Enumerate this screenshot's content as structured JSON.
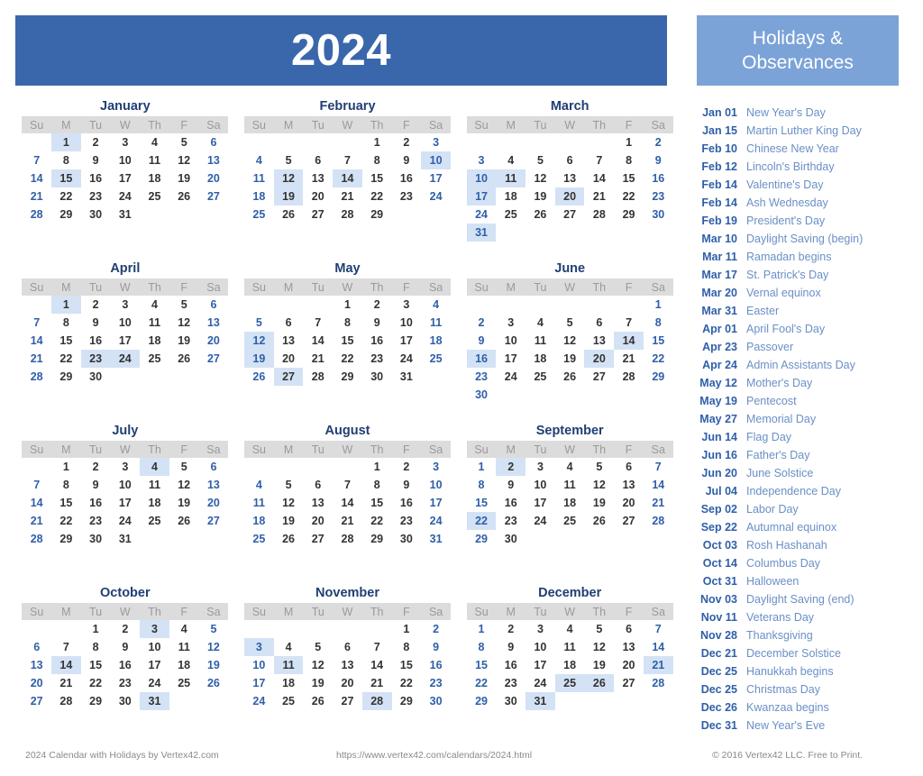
{
  "header": {
    "year": "2024",
    "holidays_title_line1": "Holidays &",
    "holidays_title_line2": "Observances"
  },
  "weekdays": [
    "Su",
    "M",
    "Tu",
    "W",
    "Th",
    "F",
    "Sa"
  ],
  "colors": {
    "banner_blue": "#3a67ab",
    "holidays_banner_blue": "#7ba3d8",
    "weekday_header_gray": "#dcdcdc",
    "weekend_blue": "#2f5fa8",
    "weekday_text": "#333333",
    "highlight_blue": "#d4e2f5",
    "month_title_blue": "#1f3f73",
    "holiday_name_blue": "#6a8fc7",
    "footer_gray": "#8a8a8a"
  },
  "months": [
    {
      "name": "January",
      "first_weekday": 1,
      "days": 31,
      "highlights": [
        1,
        15
      ]
    },
    {
      "name": "February",
      "first_weekday": 4,
      "days": 29,
      "highlights": [
        10,
        12,
        14,
        19
      ]
    },
    {
      "name": "March",
      "first_weekday": 5,
      "days": 31,
      "highlights": [
        10,
        11,
        17,
        20,
        31
      ]
    },
    {
      "name": "April",
      "first_weekday": 1,
      "days": 30,
      "highlights": [
        1,
        23,
        24
      ]
    },
    {
      "name": "May",
      "first_weekday": 3,
      "days": 31,
      "highlights": [
        12,
        19,
        27
      ]
    },
    {
      "name": "June",
      "first_weekday": 6,
      "days": 30,
      "highlights": [
        14,
        16,
        20
      ]
    },
    {
      "name": "July",
      "first_weekday": 1,
      "days": 31,
      "highlights": [
        4
      ]
    },
    {
      "name": "August",
      "first_weekday": 4,
      "days": 31,
      "highlights": []
    },
    {
      "name": "September",
      "first_weekday": 0,
      "days": 30,
      "highlights": [
        2,
        22
      ]
    },
    {
      "name": "October",
      "first_weekday": 2,
      "days": 31,
      "highlights": [
        3,
        14,
        31
      ]
    },
    {
      "name": "November",
      "first_weekday": 5,
      "days": 30,
      "highlights": [
        3,
        11,
        28
      ]
    },
    {
      "name": "December",
      "first_weekday": 0,
      "days": 31,
      "highlights": [
        21,
        25,
        26,
        31
      ]
    }
  ],
  "holidays": [
    {
      "date": "Jan 01",
      "name": "New Year's Day"
    },
    {
      "date": "Jan 15",
      "name": "Martin Luther King Day"
    },
    {
      "date": "Feb 10",
      "name": "Chinese New Year"
    },
    {
      "date": "Feb 12",
      "name": "Lincoln's Birthday"
    },
    {
      "date": "Feb 14",
      "name": "Valentine's Day"
    },
    {
      "date": "Feb 14",
      "name": "Ash Wednesday"
    },
    {
      "date": "Feb 19",
      "name": "President's Day"
    },
    {
      "date": "Mar 10",
      "name": "Daylight Saving (begin)"
    },
    {
      "date": "Mar 11",
      "name": "Ramadan begins"
    },
    {
      "date": "Mar 17",
      "name": "St. Patrick's Day"
    },
    {
      "date": "Mar 20",
      "name": "Vernal equinox"
    },
    {
      "date": "Mar 31",
      "name": "Easter"
    },
    {
      "date": "Apr 01",
      "name": "April Fool's Day"
    },
    {
      "date": "Apr 23",
      "name": "Passover"
    },
    {
      "date": "Apr 24",
      "name": "Admin Assistants Day"
    },
    {
      "date": "May 12",
      "name": "Mother's Day"
    },
    {
      "date": "May 19",
      "name": "Pentecost"
    },
    {
      "date": "May 27",
      "name": "Memorial Day"
    },
    {
      "date": "Jun 14",
      "name": "Flag Day"
    },
    {
      "date": "Jun 16",
      "name": "Father's Day"
    },
    {
      "date": "Jun 20",
      "name": "June Solstice"
    },
    {
      "date": "Jul 04",
      "name": "Independence Day"
    },
    {
      "date": "Sep 02",
      "name": "Labor Day"
    },
    {
      "date": "Sep 22",
      "name": "Autumnal equinox"
    },
    {
      "date": "Oct 03",
      "name": "Rosh Hashanah"
    },
    {
      "date": "Oct 14",
      "name": "Columbus Day"
    },
    {
      "date": "Oct 31",
      "name": "Halloween"
    },
    {
      "date": "Nov 03",
      "name": "Daylight Saving (end)"
    },
    {
      "date": "Nov 11",
      "name": "Veterans Day"
    },
    {
      "date": "Nov 28",
      "name": "Thanksgiving"
    },
    {
      "date": "Dec 21",
      "name": "December Solstice"
    },
    {
      "date": "Dec 25",
      "name": "Hanukkah begins"
    },
    {
      "date": "Dec 25",
      "name": "Christmas Day"
    },
    {
      "date": "Dec 26",
      "name": "Kwanzaa begins"
    },
    {
      "date": "Dec 31",
      "name": "New Year's Eve"
    }
  ],
  "footer": {
    "left": "2024 Calendar with Holidays by Vertex42.com",
    "middle": "https://www.vertex42.com/calendars/2024.html",
    "right": "© 2016 Vertex42 LLC. Free to Print."
  }
}
